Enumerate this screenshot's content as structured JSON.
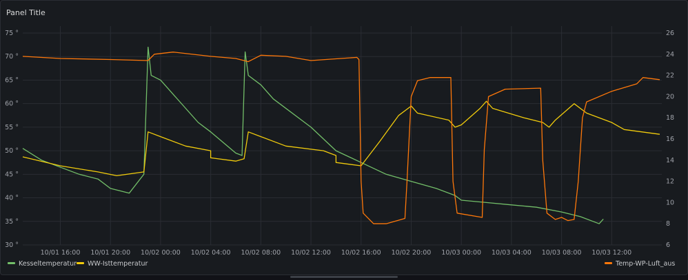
{
  "panel": {
    "title": "Panel Title"
  },
  "colors": {
    "green": "#73bf69",
    "yellow": "#f2cc0c",
    "orange": "#ff780a"
  },
  "chart_data": {
    "type": "line",
    "title": "Panel Title",
    "x_axis": {
      "type": "time",
      "range": [
        "10/01 13:00",
        "10/03 16:00"
      ],
      "ticks": [
        "10/01 16:00",
        "10/01 20:00",
        "10/02 00:00",
        "10/02 04:00",
        "10/02 08:00",
        "10/02 12:00",
        "10/02 16:00",
        "10/02 20:00",
        "10/03 00:00",
        "10/03 04:00",
        "10/03 08:00",
        "10/03 12:00"
      ]
    },
    "y_left": {
      "range": [
        30,
        75
      ],
      "unit": "°",
      "ticks": [
        "30 °",
        "35 °",
        "40 °",
        "45 °",
        "50 °",
        "55 °",
        "60 °",
        "65 °",
        "70 °",
        "75 °"
      ]
    },
    "y_right": {
      "range": [
        6,
        26
      ],
      "ticks": [
        "6",
        "8",
        "10",
        "12",
        "14",
        "16",
        "18",
        "20",
        "22",
        "24",
        "26"
      ]
    },
    "grid": true,
    "legend": {
      "placement": "bottom"
    },
    "series": [
      {
        "name": "Kesseltemperatur",
        "axis": "left",
        "color": "#73bf69",
        "points": [
          [
            "10/01 13:00",
            50.5
          ],
          [
            "10/01 14:30",
            48.0
          ],
          [
            "10/01 17:30",
            45.0
          ],
          [
            "10/01 19:00",
            44.0
          ],
          [
            "10/01 20:00",
            42.0
          ],
          [
            "10/01 21:30",
            41.0
          ],
          [
            "10/01 22:40",
            45.0
          ],
          [
            "10/01 23:00",
            72.0
          ],
          [
            "10/01 23:15",
            66.0
          ],
          [
            "10/02 00:00",
            65.0
          ],
          [
            "10/02 03:00",
            56.0
          ],
          [
            "10/02 04:00",
            54.0
          ],
          [
            "10/02 06:00",
            49.5
          ],
          [
            "10/02 06:30",
            49.0
          ],
          [
            "10/02 06:45",
            71.0
          ],
          [
            "10/02 07:00",
            66.0
          ],
          [
            "10/02 08:00",
            64.0
          ],
          [
            "10/02 09:00",
            61.0
          ],
          [
            "10/02 12:00",
            55.0
          ],
          [
            "10/02 14:00",
            50.0
          ],
          [
            "10/02 16:00",
            47.5
          ],
          [
            "10/02 18:00",
            45.0
          ],
          [
            "10/02 20:00",
            43.5
          ],
          [
            "10/02 22:00",
            42.0
          ],
          [
            "10/02 23:30",
            40.5
          ],
          [
            "10/03 00:00",
            39.5
          ],
          [
            "10/03 02:00",
            39.0
          ],
          [
            "10/03 04:00",
            38.5
          ],
          [
            "10/03 06:00",
            38.0
          ],
          [
            "10/03 08:00",
            37.0
          ],
          [
            "10/03 09:30",
            36.0
          ],
          [
            "10/03 11:00",
            34.5
          ],
          [
            "10/03 11:20",
            35.5
          ]
        ]
      },
      {
        "name": "WW-Isttemperatur",
        "axis": "left",
        "color": "#f2cc0c",
        "points": [
          [
            "10/01 13:00",
            48.7
          ],
          [
            "10/01 16:00",
            46.8
          ],
          [
            "10/01 19:00",
            45.5
          ],
          [
            "10/01 20:30",
            44.7
          ],
          [
            "10/01 22:40",
            45.5
          ],
          [
            "10/01 23:00",
            54.0
          ],
          [
            "10/02 00:00",
            53.0
          ],
          [
            "10/02 02:00",
            51.0
          ],
          [
            "10/02 04:00",
            50.0
          ],
          [
            "10/02 04:00",
            48.5
          ],
          [
            "10/02 06:00",
            47.8
          ],
          [
            "10/02 06:40",
            48.3
          ],
          [
            "10/02 07:00",
            54.0
          ],
          [
            "10/02 08:00",
            53.0
          ],
          [
            "10/02 10:00",
            51.0
          ],
          [
            "10/02 13:00",
            50.0
          ],
          [
            "10/02 14:00",
            49.0
          ],
          [
            "10/02 14:00",
            47.5
          ],
          [
            "10/02 16:00",
            46.8
          ],
          [
            "10/02 17:30",
            52.0
          ],
          [
            "10/02 19:00",
            57.5
          ],
          [
            "10/02 20:00",
            59.5
          ],
          [
            "10/02 20:30",
            58.0
          ],
          [
            "10/02 23:00",
            56.5
          ],
          [
            "10/02 23:30",
            55.0
          ],
          [
            "10/03 00:00",
            55.5
          ],
          [
            "10/03 01:30",
            59.0
          ],
          [
            "10/03 02:00",
            60.5
          ],
          [
            "10/03 02:30",
            59.0
          ],
          [
            "10/03 05:00",
            57.0
          ],
          [
            "10/03 06:30",
            56.0
          ],
          [
            "10/03 07:00",
            55.0
          ],
          [
            "10/03 07:30",
            56.5
          ],
          [
            "10/03 09:00",
            60.0
          ],
          [
            "10/03 10:00",
            58.0
          ],
          [
            "10/03 12:00",
            56.0
          ],
          [
            "10/03 13:00",
            54.5
          ],
          [
            "10/03 15:50",
            53.5
          ]
        ]
      },
      {
        "name": "Temp-WP-Luft_aus",
        "axis": "right",
        "color": "#ff780a",
        "points": [
          [
            "10/01 13:00",
            23.8
          ],
          [
            "10/01 16:00",
            23.6
          ],
          [
            "10/01 20:00",
            23.5
          ],
          [
            "10/01 23:00",
            23.4
          ],
          [
            "10/01 23:30",
            24.0
          ],
          [
            "10/02 01:00",
            24.2
          ],
          [
            "10/02 04:00",
            23.8
          ],
          [
            "10/02 06:00",
            23.6
          ],
          [
            "10/02 07:00",
            23.3
          ],
          [
            "10/02 08:00",
            23.9
          ],
          [
            "10/02 10:00",
            23.8
          ],
          [
            "10/02 12:00",
            23.4
          ],
          [
            "10/02 15:40",
            23.7
          ],
          [
            "10/02 15:50",
            23.5
          ],
          [
            "10/02 16:00",
            12.0
          ],
          [
            "10/02 16:10",
            9.0
          ],
          [
            "10/02 17:00",
            8.0
          ],
          [
            "10/02 18:00",
            8.0
          ],
          [
            "10/02 19:30",
            8.5
          ],
          [
            "10/02 19:40",
            12.0
          ],
          [
            "10/02 20:00",
            20.0
          ],
          [
            "10/02 20:30",
            21.5
          ],
          [
            "10/02 21:30",
            21.8
          ],
          [
            "10/02 23:10",
            21.8
          ],
          [
            "10/02 23:20",
            12.0
          ],
          [
            "10/02 23:40",
            9.0
          ],
          [
            "10/03 01:40",
            8.6
          ],
          [
            "10/03 01:50",
            15.0
          ],
          [
            "10/03 02:10",
            20.0
          ],
          [
            "10/03 03:30",
            20.7
          ],
          [
            "10/03 06:20",
            20.8
          ],
          [
            "10/03 06:30",
            14.0
          ],
          [
            "10/03 06:50",
            9.0
          ],
          [
            "10/03 07:30",
            8.4
          ],
          [
            "10/03 08:00",
            8.6
          ],
          [
            "10/03 08:30",
            8.3
          ],
          [
            "10/03 09:00",
            8.4
          ],
          [
            "10/03 09:20",
            12.0
          ],
          [
            "10/03 09:40",
            18.0
          ],
          [
            "10/03 10:00",
            19.5
          ],
          [
            "10/03 12:00",
            20.5
          ],
          [
            "10/03 14:00",
            21.2
          ],
          [
            "10/03 14:30",
            21.8
          ],
          [
            "10/03 15:50",
            21.6
          ]
        ]
      }
    ]
  }
}
